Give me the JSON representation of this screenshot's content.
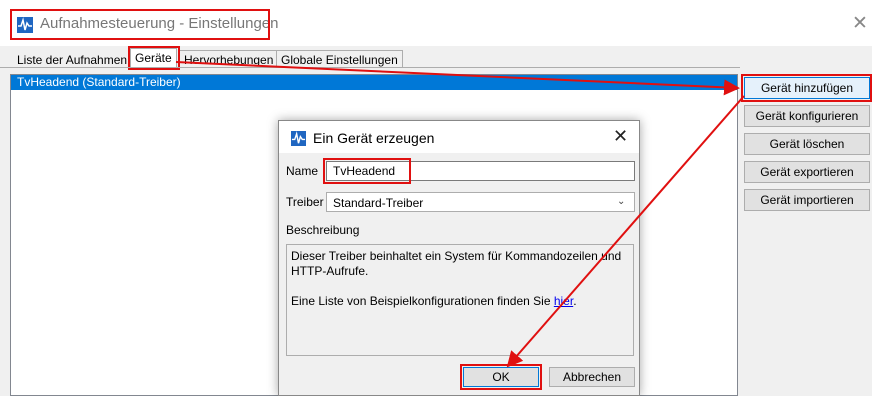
{
  "window": {
    "title": "Aufnahmesteuerung - Einstellungen",
    "close_glyph": "✕"
  },
  "tabs": [
    {
      "label": "Liste der Aufnahmen"
    },
    {
      "label": "Geräte"
    },
    {
      "label": "Hervorhebungen"
    },
    {
      "label": "Globale Einstellungen"
    }
  ],
  "active_tab": "Geräte",
  "device_list": {
    "items": [
      {
        "label": "TvHeadend (Standard-Treiber)",
        "selected": true
      }
    ]
  },
  "side_buttons": {
    "add": "Gerät hinzufügen",
    "configure": "Gerät konfigurieren",
    "delete": "Gerät löschen",
    "export": "Gerät exportieren",
    "import": "Gerät importieren"
  },
  "dialog": {
    "title": "Ein Gerät erzeugen",
    "close_glyph": "✕",
    "name_label": "Name",
    "name_value": "TvHeadend",
    "driver_label": "Treiber",
    "driver_value": "Standard-Treiber",
    "description_label": "Beschreibung",
    "description_text": "Dieser Treiber beinhaltet ein System für Kommandozeilen und HTTP-Aufrufe.",
    "description_link_prefix": "Eine Liste von Beispielkonfigurationen finden Sie ",
    "description_link_text": "hier",
    "description_link_suffix": ".",
    "ok_label": "OK",
    "cancel_label": "Abbrechen"
  },
  "colors": {
    "selection": "#0078d7",
    "annotation": "#e01010",
    "link": "#0000ee"
  },
  "icons": {
    "app": "waveform-icon",
    "dropdown": "chevron-down-icon",
    "close": "close-icon"
  }
}
